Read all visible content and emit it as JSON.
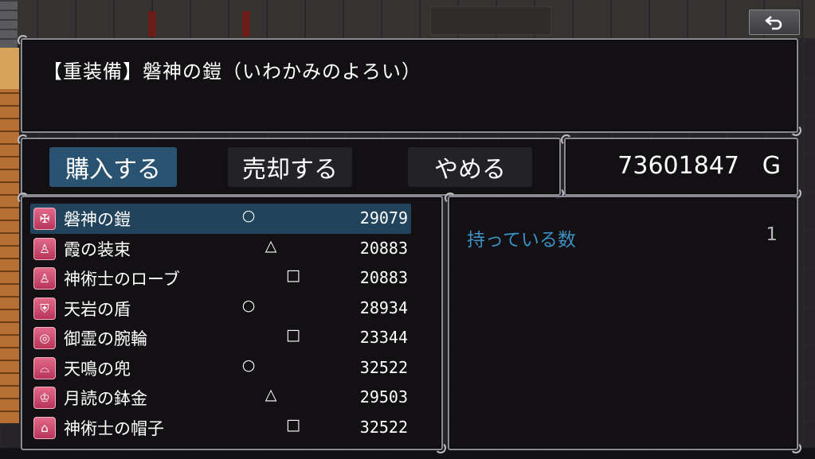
{
  "help": {
    "text": "【重装備】磐神の鎧（いわかみのよろい）"
  },
  "commands": [
    {
      "label": "購入する",
      "selected": true
    },
    {
      "label": "売却する",
      "selected": false
    },
    {
      "label": "やめる",
      "selected": false
    }
  ],
  "gold": {
    "amount": "73601847",
    "unit": "G"
  },
  "items": [
    {
      "name": "磐神の鎧",
      "mark": "○",
      "price": "29079",
      "icon": "armor-icon",
      "selected": true
    },
    {
      "name": "霞の装束",
      "mark": "△",
      "price": "20883",
      "icon": "robe-icon",
      "selected": false
    },
    {
      "name": "神術士のローブ",
      "mark": "□",
      "price": "20883",
      "icon": "robe-icon",
      "selected": false
    },
    {
      "name": "天岩の盾",
      "mark": "○",
      "price": "28934",
      "icon": "shield-icon",
      "selected": false
    },
    {
      "name": "御霊の腕輪",
      "mark": "□",
      "price": "23344",
      "icon": "bracelet-icon",
      "selected": false
    },
    {
      "name": "天鳴の兜",
      "mark": "○",
      "price": "32522",
      "icon": "helmet-icon",
      "selected": false
    },
    {
      "name": "月読の鉢金",
      "mark": "△",
      "price": "29503",
      "icon": "headband-icon",
      "selected": false
    },
    {
      "name": "神術士の帽子",
      "mark": "□",
      "price": "32522",
      "icon": "hat-icon",
      "selected": false
    }
  ],
  "status": {
    "owned_label": "持っている数",
    "owned_value": "1"
  },
  "colors": {
    "selected_row": "#22435c",
    "selected_command": "#2a5271",
    "label_blue": "#3d90c2",
    "icon_pink": "#d64c74"
  }
}
